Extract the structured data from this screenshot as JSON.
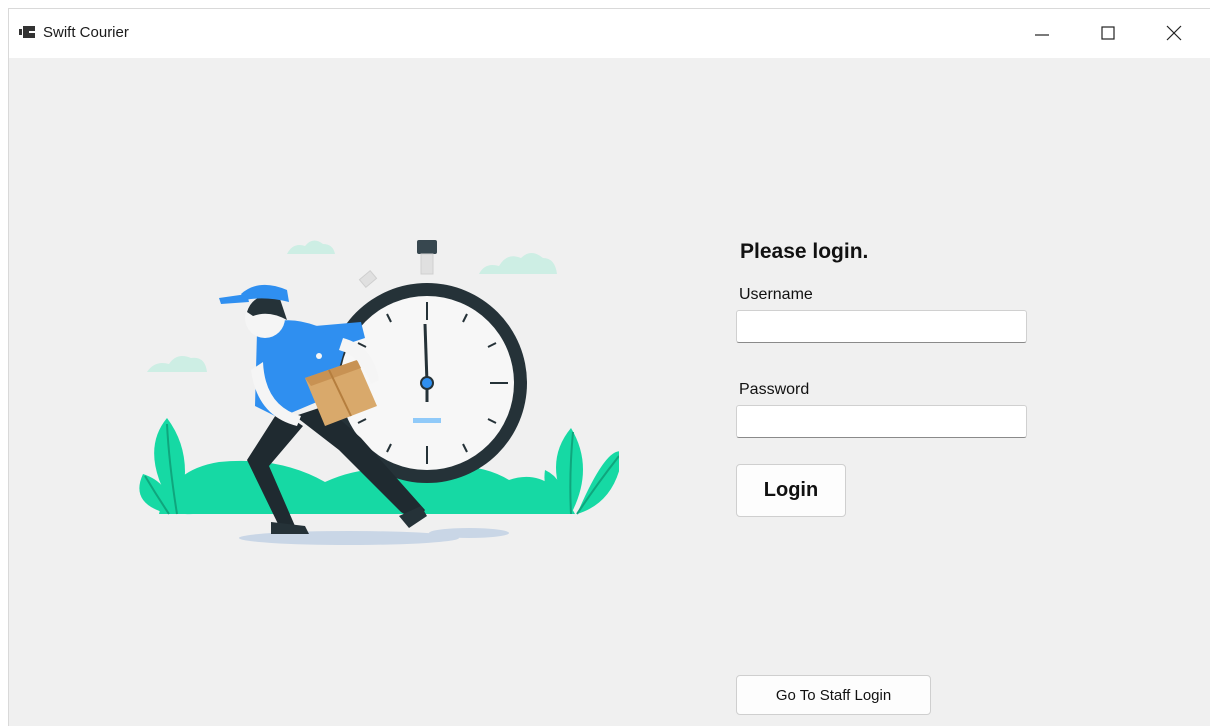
{
  "window": {
    "title": "Swift Courier",
    "icons": {
      "app": "app-icon",
      "minimize": "minimize-icon",
      "maximize": "maximize-icon",
      "close": "close-icon"
    }
  },
  "illustration": {
    "name": "courier-illustration"
  },
  "login": {
    "heading": "Please login.",
    "username_label": "Username",
    "username_value": "",
    "password_label": "Password",
    "password_value": "",
    "login_button": "Login",
    "staff_button": "Go To Staff Login"
  },
  "colors": {
    "accent_blue": "#2f8ff0",
    "grass": "#16d9a4",
    "background": "#f0f0f0"
  }
}
